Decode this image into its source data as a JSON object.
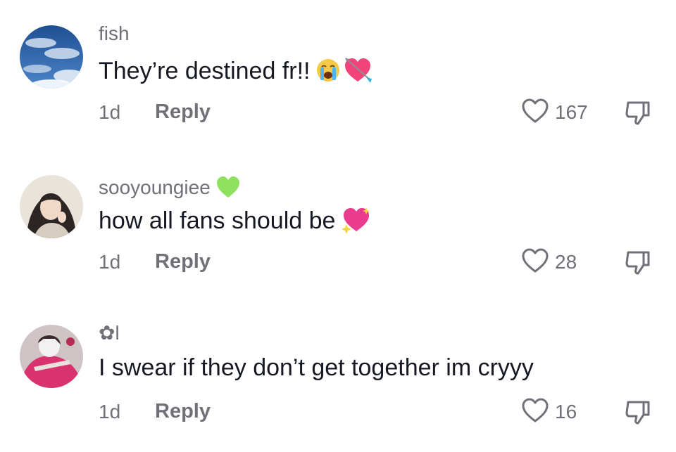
{
  "comments": [
    {
      "username": "fish",
      "text": "They’re destined fr!!",
      "emojis": [
        "loudly-crying-face-emoji",
        "heart-with-arrow-emoji"
      ],
      "time": "1d",
      "reply_label": "Reply",
      "like_count": "167"
    },
    {
      "username": "sooyoungiee",
      "username_badge": "green-heart-emoji",
      "text": "how all fans should be",
      "emojis": [
        "sparkling-heart-emoji"
      ],
      "time": "1d",
      "reply_label": "Reply",
      "like_count": "28"
    },
    {
      "username": "✿l",
      "text": "I swear if they don’t get together im cryyy",
      "emojis": [],
      "time": "1d",
      "reply_label": "Reply",
      "like_count": "16"
    }
  ],
  "colors": {
    "primary_text": "#161823",
    "secondary_text": "#6f7078",
    "background": "#ffffff"
  }
}
